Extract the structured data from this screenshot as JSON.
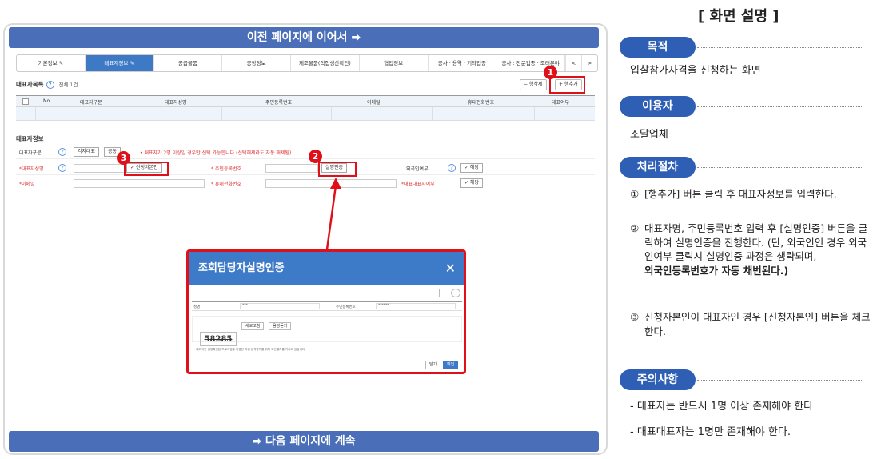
{
  "top_bar": "이전 페이지에 이어서 ➡",
  "bottom_bar": "➡ 다음 페이지에 계속",
  "tabs": [
    "기본정보 ✎",
    "대표자정보 ✎",
    "공급물품",
    "공장정보",
    "제조물품(직접생산확인)",
    "협업정보",
    "공사 · 용역 · 기타업종",
    "공사 : 전문업종 · 조래분야"
  ],
  "tab_nav": [
    "<",
    ">"
  ],
  "rep_list": {
    "title": "대표자목록",
    "count": "전체 1건",
    "btn_del": "− 행삭제",
    "btn_add": "+ 행추가"
  },
  "columns": [
    "No",
    "대표자구분",
    "대표자성명",
    "주민등록번호",
    "이메일",
    "휴대전화번호",
    "대표여부"
  ],
  "rep_info": {
    "title": "대표자정보",
    "type_label": "대표자구분",
    "type_val1": "각자대표",
    "type_val2": "공동",
    "notice": "• 대표자가 2명 이상일 경우만 선택 가능합니다.(선택해제라도 자동 해제됨)",
    "name_label": "*대표자성명",
    "self_btn": "✓ 신청자본인",
    "rrn_label": "* 주민등록번호",
    "verify_btn": "실명인증",
    "foreign_label": "외국인여부",
    "yes1": "✓ 해당",
    "email_label": "*이메일",
    "phone_label": "* 휴대전화번호",
    "main_label": "*대표대표자여부",
    "yes2": "✓ 해당"
  },
  "badges": [
    "1",
    "2",
    "3"
  ],
  "modal": {
    "title": "조회담당자실명인증",
    "close": "✕",
    "f1": "성명",
    "f1v": "***",
    "f2": "주민등록번호",
    "f2v": "****** · ·······",
    "captcha": "58285",
    "cap_btn1": "새로고침",
    "cap_btn2": "음성듣기",
    "note": "• 내외국인 실명확인은 프로그램을 이용한 허위 입력방지를 위해 보안절차를 거치고 있습니다.",
    "btn_cancel": "닫기",
    "btn_ok": "확인"
  },
  "right": {
    "title": "[ 화면 설명 ]",
    "purpose_label": "목적",
    "purpose": "입찰참가자격을 신청하는 화면",
    "user_label": "이용자",
    "user": "조달업체",
    "proc_label": "처리절차",
    "s1n": "①",
    "s1": "[행추가] 버튼 클릭 후 대표자정보를 입력한다.",
    "s2n": "②",
    "s2a": "대표자명, 주민등록번호 입력 후 [실명인증] 버튼을 클릭하여 실명인증을 진행한다. (단, 외국인인 경우 외국인여부 클릭시 실명인증 과정은 생략되며,",
    "s2b": "외국인등록번호가 자동 채번된다.)",
    "s3n": "③",
    "s3": "신청자본인이 대표자인 경우 [신청자본인] 버튼을 체크한다.",
    "note_label": "주의사항",
    "n1": "- 대표자는 반드시 1명 이상 존재해야 한다",
    "n2": "- 대표대표자는 1명만 존재해야 한다."
  },
  "colors": {
    "accent": "#4a6fb8",
    "pill": "#2e5fb5",
    "highlight": "#e0101a"
  }
}
